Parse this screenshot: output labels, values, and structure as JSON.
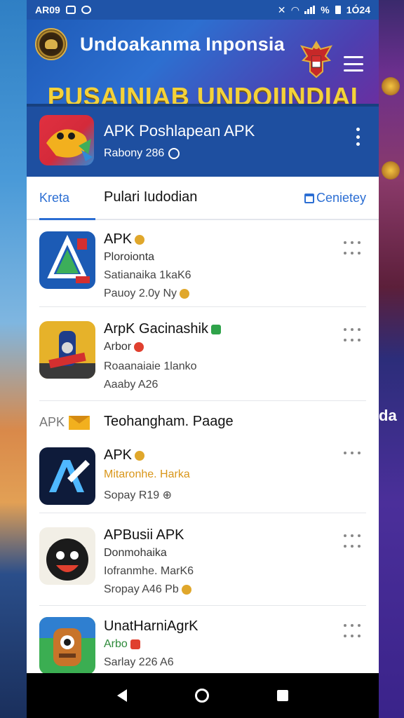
{
  "status_bar": {
    "left_text": "AR09",
    "right_text": "1Ó24",
    "battery_text": "%"
  },
  "header": {
    "title": "Undoakanma Inponsia",
    "banner": "PUSAINIAB UNDOIINDIAI"
  },
  "featured": {
    "title": "APK Poshlapean APK",
    "subtitle": "Rabony 286"
  },
  "tabs": {
    "left": "Kreta",
    "main": "Pulari Iudodian",
    "right": "Cenietey"
  },
  "list": [
    {
      "title": "APK",
      "line2": "Ploroionta",
      "line3": "Satianaika 1kaK6",
      "line4": "Pauoy 2.0y Ny"
    },
    {
      "title": "ArpK Gacinashik",
      "line2": "Arbor",
      "line3": "Roaanaiaie 1lanko",
      "line4": "Aaaby A26"
    }
  ],
  "section": {
    "left_label": "APK",
    "title": "Teohangham. Paage"
  },
  "list2": [
    {
      "title": "APK",
      "line2": "Mitaronhe. Harka",
      "line3": "Sopay R19"
    },
    {
      "title": "APBusii APK",
      "line2": "Donmohaika",
      "line3": "Iofranmhe. MarK6",
      "line4": "Sropay A46 Pb"
    },
    {
      "title": "UnatHarniAgrK",
      "line2": "Arbo",
      "line3": "Sarlay 226 A6"
    }
  ],
  "side_text": "da",
  "colors": {
    "header_blue": "#1e5bb8",
    "featured_blue": "#1e4fa0",
    "accent_blue": "#2b6ed3",
    "banner_gold": "#f4d23a",
    "orange_text": "#d9961a",
    "green_text": "#2d8a3a"
  }
}
